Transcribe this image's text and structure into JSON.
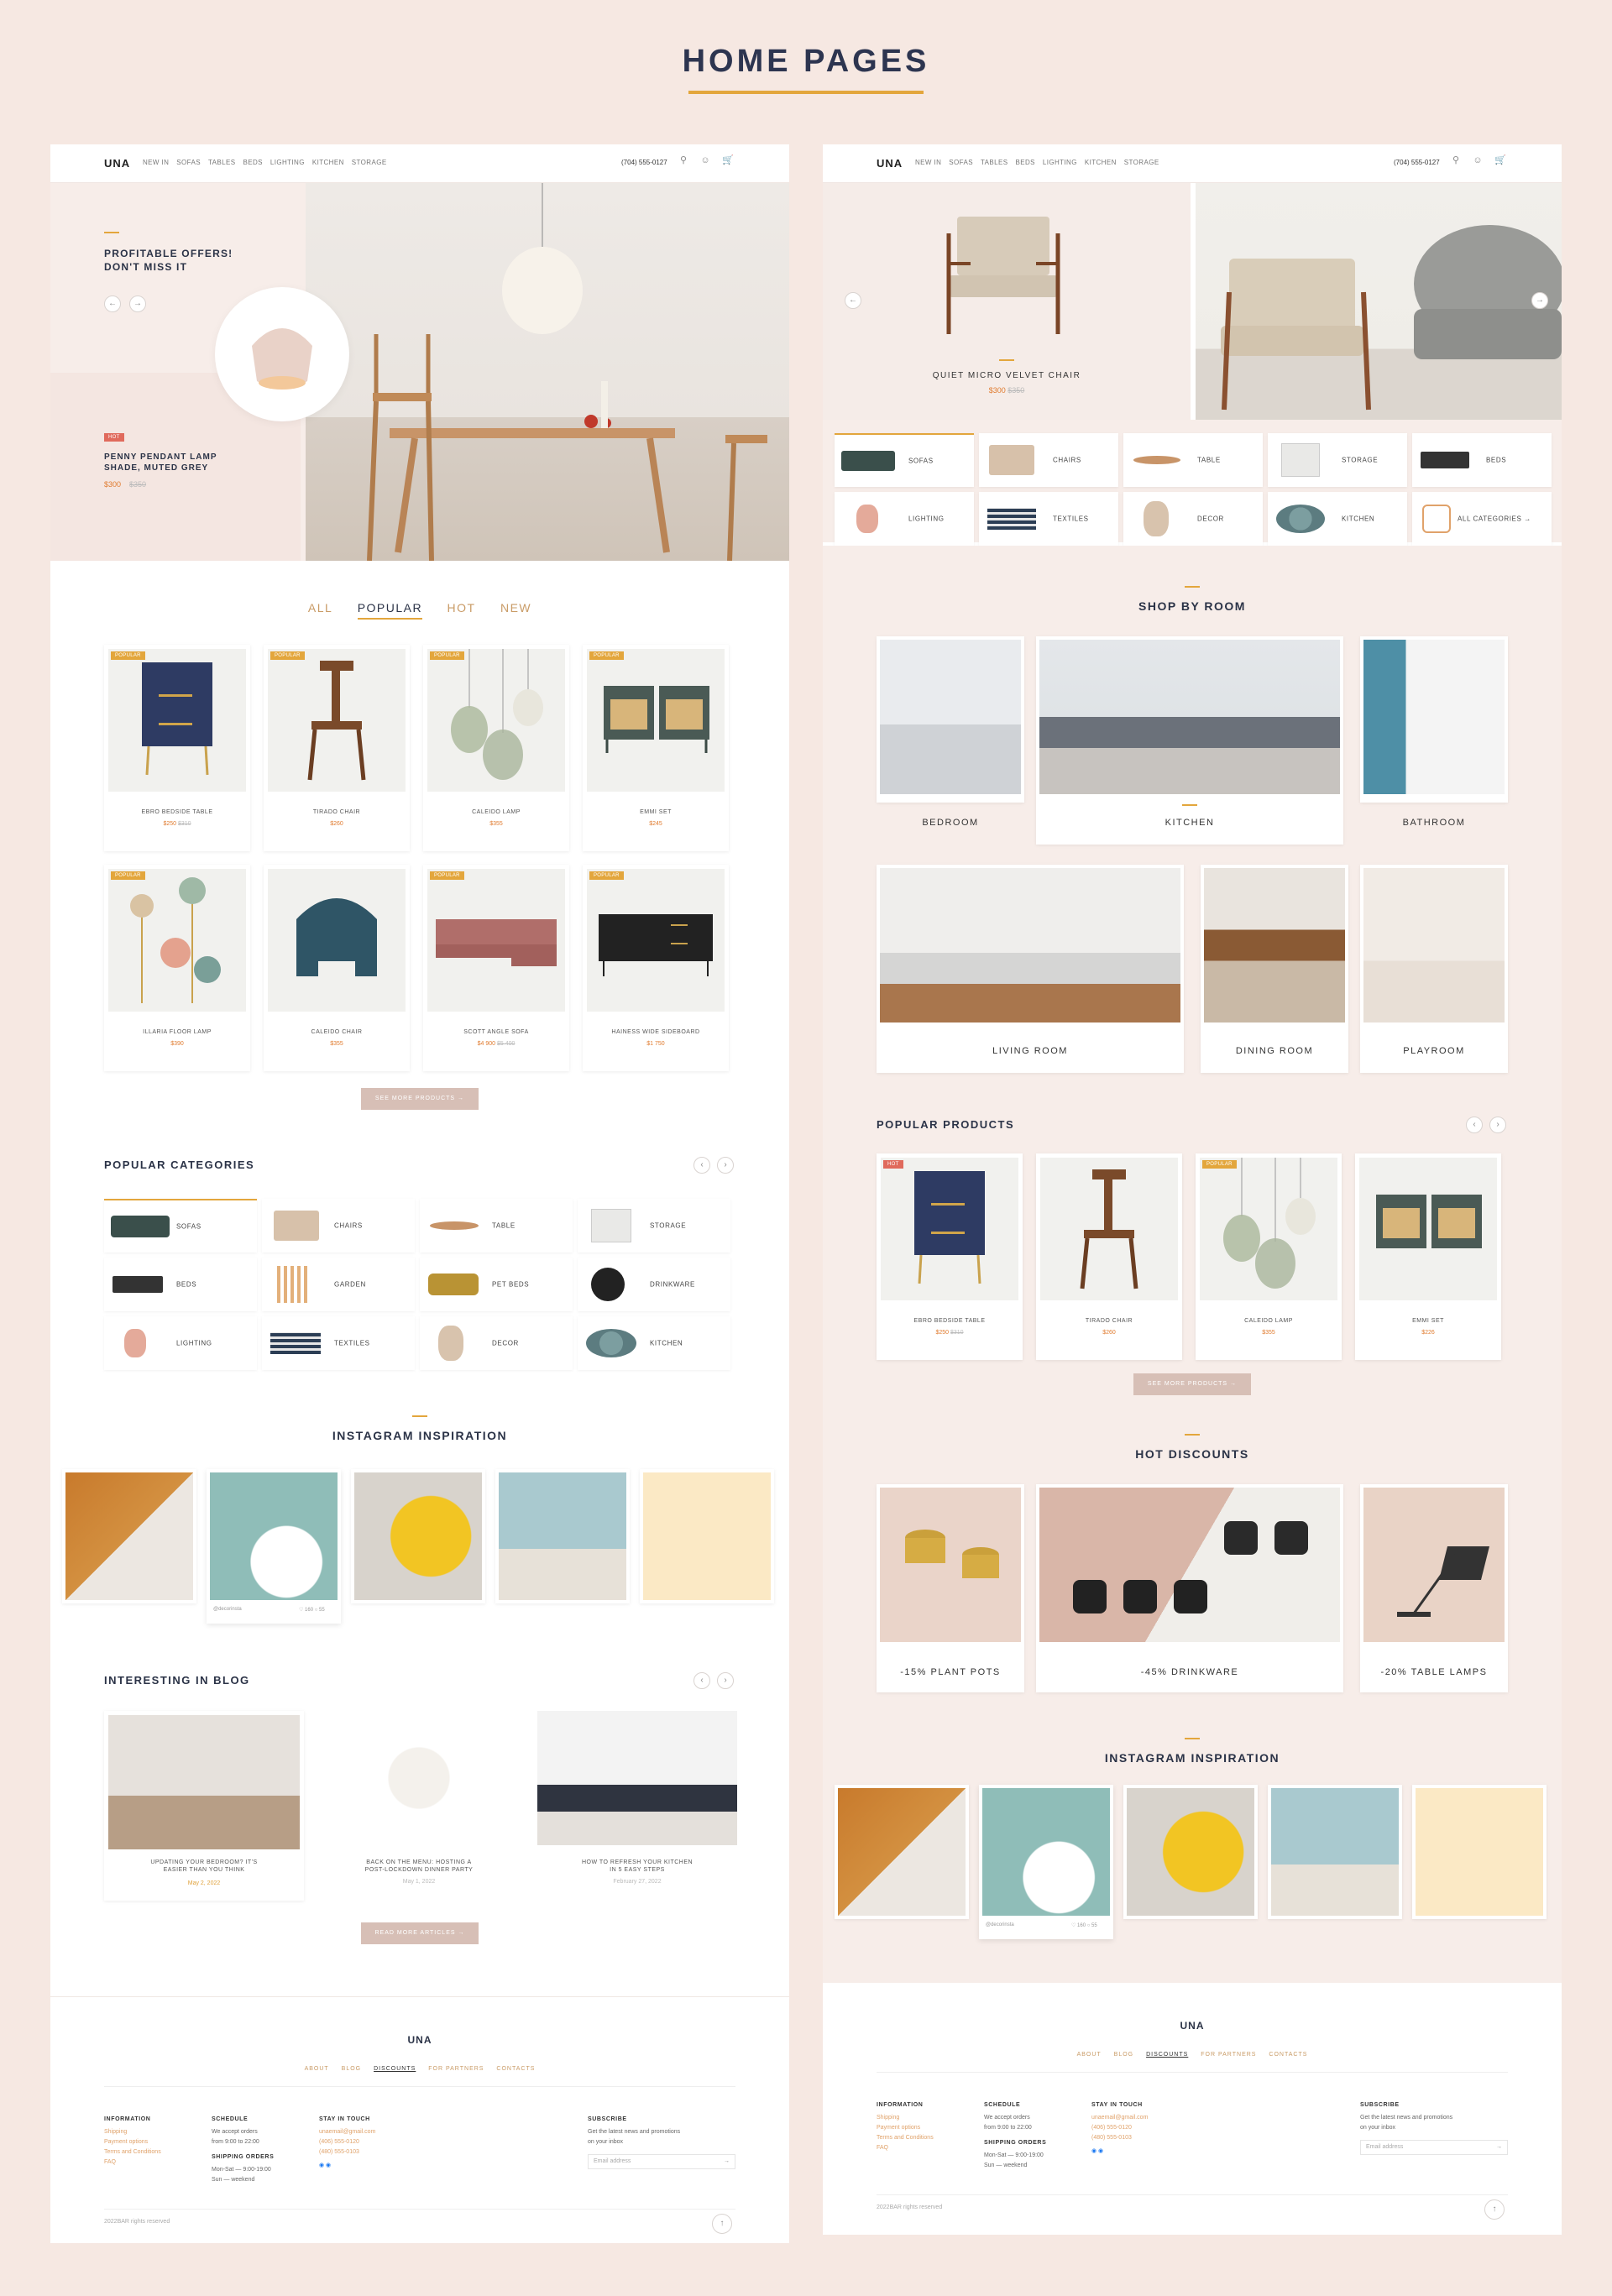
{
  "page": {
    "title": "HOME PAGES"
  },
  "colors": {
    "accent": "#e3a63c",
    "background": "#f6e8e2",
    "button": "#d7bfb6",
    "price": "#e07b2f"
  },
  "nav": {
    "logo": "UNA",
    "items": [
      "NEW IN",
      "SOFAS",
      "TABLES",
      "BEDS",
      "LIGHTING",
      "KITCHEN",
      "STORAGE"
    ],
    "phone": "(704) 555-0127",
    "icons": [
      "search-icon",
      "user-icon",
      "cart-icon"
    ]
  },
  "left": {
    "hero": {
      "offer_title": "PROFITABLE OFFERS!\nDON'T MISS IT",
      "badge": "HOT",
      "product_name": "PENNY PENDANT LAMP\nSHADE, MUTED GREY",
      "price": "$300",
      "old_price": "$350"
    },
    "tabs": [
      "ALL",
      "POPULAR",
      "HOT",
      "NEW"
    ],
    "active_tab": "POPULAR",
    "products": [
      {
        "badge": "POPULAR",
        "name": "EBRO BEDSIDE TABLE",
        "price": "$250",
        "old": "$310"
      },
      {
        "badge": "POPULAR",
        "name": "TIRADO CHAIR",
        "price": "$260",
        "old": ""
      },
      {
        "badge": "POPULAR",
        "name": "CALEIDO LAMP",
        "price": "$355",
        "old": ""
      },
      {
        "badge": "POPULAR",
        "name": "EMMI SET",
        "price": "$245",
        "old": ""
      },
      {
        "badge": "POPULAR",
        "name": "ILLARIA FLOOR LAMP",
        "price": "$390",
        "old": ""
      },
      {
        "badge": "",
        "name": "CALEIDO CHAIR",
        "price": "$355",
        "old": ""
      },
      {
        "badge": "POPULAR",
        "name": "SCOTT ANGLE SOFA",
        "price": "$4 900",
        "old": "$5 400"
      },
      {
        "badge": "POPULAR",
        "name": "HAINESS WIDE SIDEBOARD",
        "price": "$1 750",
        "old": ""
      }
    ],
    "see_more": "SEE MORE PRODUCTS",
    "popular_categories_title": "POPULAR CATEGORIES",
    "categories": [
      "SOFAS",
      "CHAIRS",
      "TABLE",
      "STORAGE",
      "BEDS",
      "GARDEN",
      "PET BEDS",
      "DRINKWARE",
      "LIGHTING",
      "TEXTILES",
      "DECOR",
      "KITCHEN"
    ],
    "instagram_title": "INSTAGRAM INSPIRATION",
    "instagram": {
      "handle": "@decorinsta",
      "likes": "160",
      "comments": "55"
    },
    "blog_title": "INTERESTING IN BLOG",
    "blog": [
      {
        "title": "UPDATING YOUR BEDROOM? IT'S\nEASIER THAN YOU THINK",
        "date": "May 2, 2022"
      },
      {
        "title": "BACK ON THE MENU: HOSTING A\nPOST-LOCKDOWN DINNER PARTY",
        "date": "May 1, 2022"
      },
      {
        "title": "HOW TO REFRESH YOUR KITCHEN\nIN 5 EASY STEPS",
        "date": "February 27, 2022"
      }
    ],
    "read_more": "READ MORE ARTICLES"
  },
  "right": {
    "hero": {
      "product_name": "QUIET MICRO VELVET CHAIR",
      "price": "$300",
      "old_price": "$350"
    },
    "categories": [
      "SOFAS",
      "CHAIRS",
      "TABLE",
      "STORAGE",
      "BEDS",
      "LIGHTING",
      "TEXTILES",
      "DECOR",
      "KITCHEN",
      "ALL CATEGORIES"
    ],
    "shop_by_room_title": "SHOP BY ROOM",
    "rooms": [
      "BEDROOM",
      "KITCHEN",
      "BATHROOM",
      "LIVING ROOM",
      "DINING ROOM",
      "PLAYROOM"
    ],
    "popular_title": "POPULAR PRODUCTS",
    "products": [
      {
        "badge": "HOT",
        "name": "EBRO BEDSIDE TABLE",
        "price": "$250",
        "old": "$310"
      },
      {
        "badge": "",
        "name": "TIRADO CHAIR",
        "price": "$260",
        "old": ""
      },
      {
        "badge": "POPULAR",
        "name": "CALEIDO LAMP",
        "price": "$355",
        "old": ""
      },
      {
        "badge": "",
        "name": "EMMI SET",
        "price": "$226",
        "old": ""
      }
    ],
    "see_more": "SEE MORE PRODUCTS",
    "hot_title": "HOT DISCOUNTS",
    "discounts": [
      "-15% PLANT POTS",
      "-45% DRINKWARE",
      "-20% TABLE LAMPS"
    ],
    "instagram_title": "INSTAGRAM INSPIRATION",
    "instagram": {
      "handle": "@decorinsta",
      "likes": "160",
      "comments": "55"
    }
  },
  "footer": {
    "logo": "UNA",
    "links": [
      "ABOUT",
      "BLOG",
      "DISCOUNTS",
      "FOR PARTNERS",
      "CONTACTS"
    ],
    "info_title": "INFORMATION",
    "info_links": [
      "Shipping",
      "Payment options",
      "Terms and Conditions",
      "FAQ"
    ],
    "schedule_title": "SCHEDULE",
    "schedule_text": "We accept orders\nfrom 9:00 to 22:00",
    "shipping_title": "SHIPPING ORDERS",
    "shipping_text": "Mon-Sat — 9:00-19:00\nSun — weekend",
    "touch_title": "STAY IN TOUCH",
    "email": "unaemail@gmail.com",
    "phone1": "(406) 555-0120",
    "phone2": "(480) 555-0103",
    "subscribe_title": "SUBSCRIBE",
    "subscribe_text": "Get the latest news and promotions\non your inbox",
    "email_placeholder": "Email address",
    "copyright": "2022BAR rights reserved"
  }
}
